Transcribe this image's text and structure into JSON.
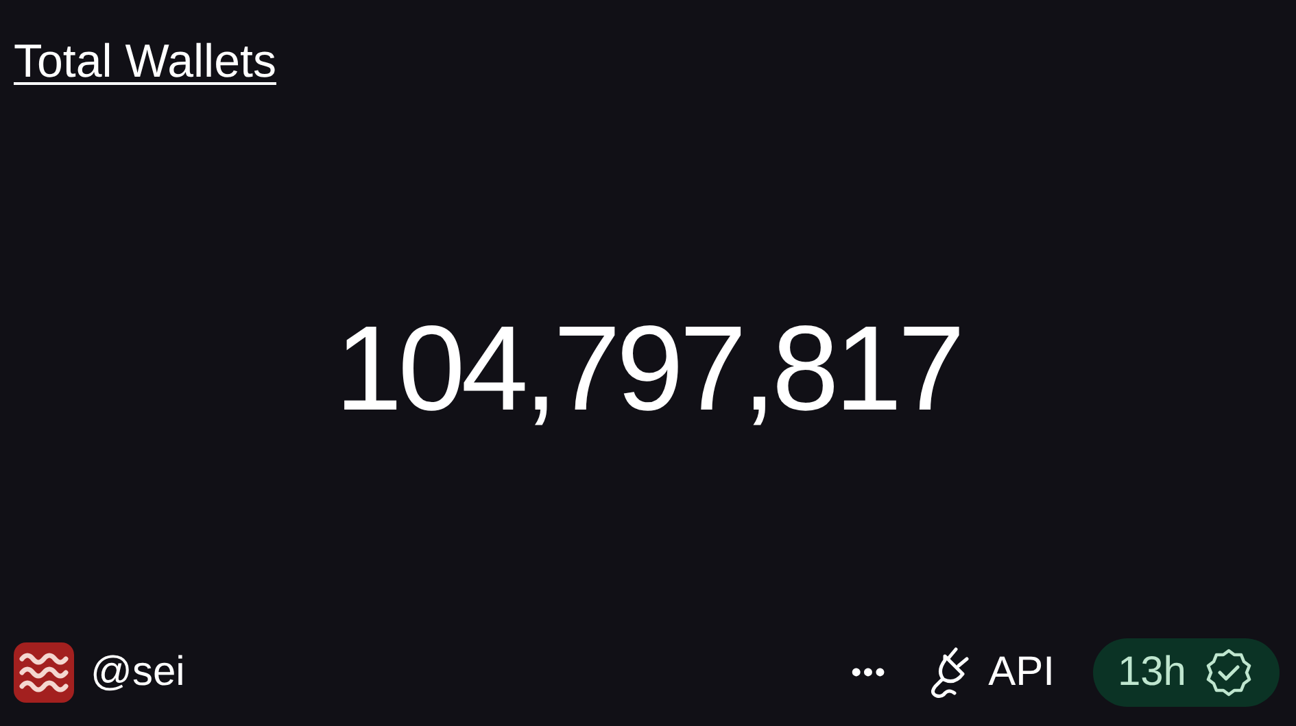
{
  "title": "Total Wallets",
  "value": "104,797,817",
  "footer": {
    "author": "@sei",
    "more": "•••",
    "api": "API",
    "freshness": "13h"
  }
}
